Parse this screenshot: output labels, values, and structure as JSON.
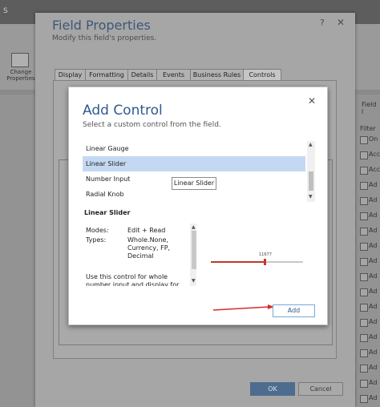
{
  "background_app": {
    "topbar_text": "S",
    "ribbon_button": "Change Properties",
    "right_panel": {
      "header": "Field l",
      "filter_label": "Filter",
      "rows": [
        "On",
        "Acc",
        "Acc",
        "Ad",
        "Ad",
        "Ad",
        "Ad",
        "Ad",
        "Ad",
        "Ad",
        "Ad",
        "Ad",
        "Ad",
        "Ad",
        "Ad",
        "Ad",
        "Ad",
        "Ad"
      ]
    }
  },
  "field_properties": {
    "title": "Field Properties",
    "subtitle": "Modify this field's properties.",
    "tabs": [
      "Display",
      "Formatting",
      "Details",
      "Events",
      "Business Rules",
      "Controls"
    ],
    "active_tab": "Controls",
    "ok_label": "OK",
    "cancel_label": "Cancel"
  },
  "add_control": {
    "title": "Add Control",
    "subtitle": "Select a custom control from the field.",
    "controls": [
      "Linear Gauge",
      "Linear Slider",
      "Number Input",
      "Radial Knob"
    ],
    "selected": "Linear Slider",
    "tooltip": "Linear Slider",
    "control_title": "Linear Slider",
    "modes_label": "Modes:",
    "modes_value": "Edit + Read",
    "types_label": "Types:",
    "types_value": "Whole.None, Currency, FP, Decimal",
    "description": "Use this control for whole number input and display for any numeric",
    "slider_value": "11677",
    "slider_fraction": 0.58,
    "add_label": "Add"
  }
}
